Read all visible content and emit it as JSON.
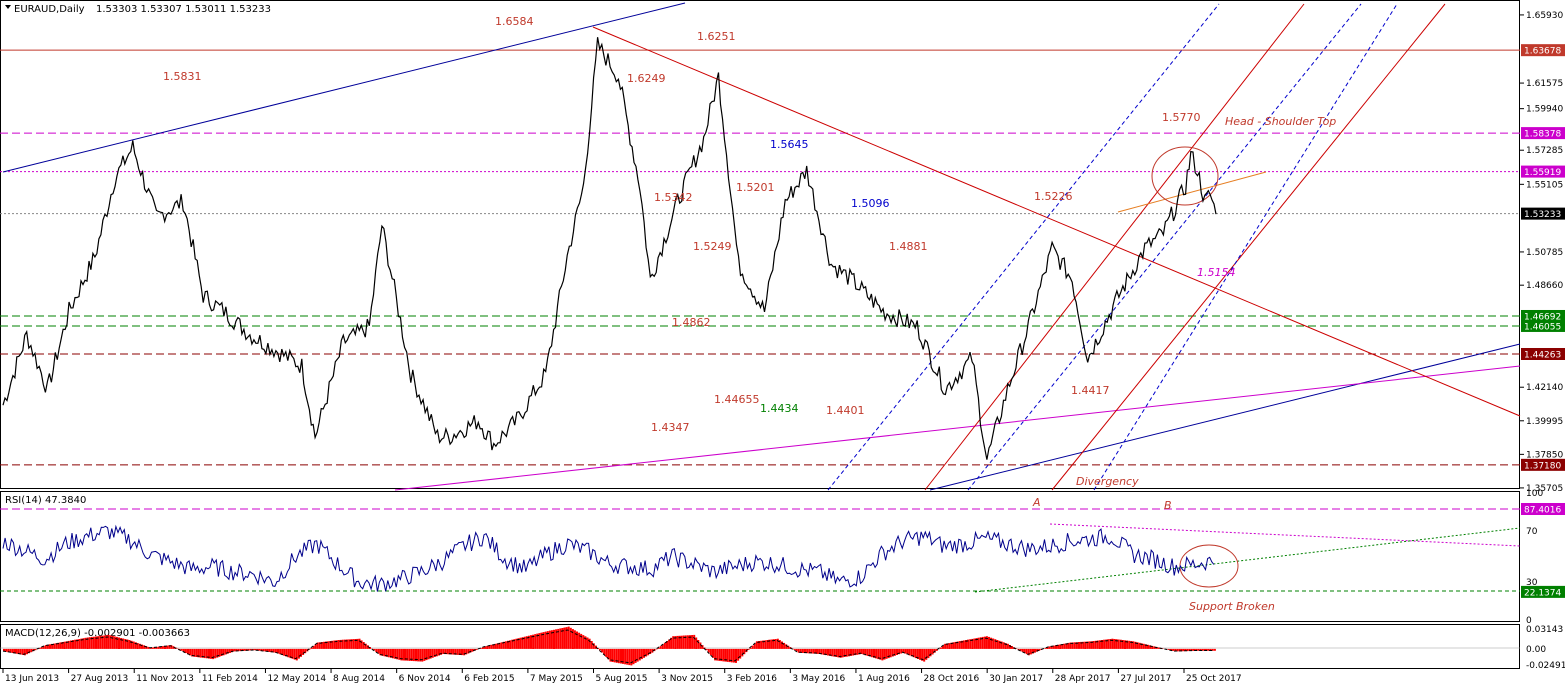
{
  "window": {
    "symbol": "EURAUD,Daily",
    "ohlc": "1.53303 1.53307 1.53011 1.53233"
  },
  "panels": {
    "rsi_title": "RSI(14) 47.3840",
    "macd_title": "MACD(12,26,9) -0.002901 -0.003663"
  },
  "colors": {
    "price": "#000000",
    "level_red": "#c0392b",
    "level_magenta": "#cc00cc",
    "level_green": "#008000",
    "trend_blue": "#000099",
    "rsi": "#00008b",
    "macd_hist": "#ff0000"
  },
  "chart_data": [
    {
      "type": "line",
      "title": "EURAUD,Daily",
      "series_name": "EURAUD",
      "x": [
        "2013-06-13",
        "2013-07-15",
        "2013-08-12",
        "2013-09-10",
        "2013-10-15",
        "2013-11-11",
        "2013-12-05",
        "2014-01-06",
        "2014-02-11",
        "2014-03-10",
        "2014-04-07",
        "2014-05-12",
        "2014-06-16",
        "2014-07-21",
        "2014-08-08",
        "2014-09-15",
        "2014-10-20",
        "2014-11-06",
        "2014-12-15",
        "2015-01-20",
        "2015-02-06",
        "2015-03-16",
        "2015-04-06",
        "2015-05-07",
        "2015-06-15",
        "2015-07-14",
        "2015-08-05",
        "2015-08-24",
        "2015-09-21",
        "2015-10-20",
        "2015-11-03",
        "2015-12-10",
        "2016-01-14",
        "2016-02-03",
        "2016-03-01",
        "2016-04-05",
        "2016-05-03",
        "2016-06-01",
        "2016-07-04",
        "2016-08-01",
        "2016-09-12",
        "2016-10-28",
        "2016-12-05",
        "2017-01-10",
        "2017-01-30",
        "2017-02-27",
        "2017-03-27",
        "2017-04-28",
        "2017-05-25",
        "2017-06-15",
        "2017-07-27",
        "2017-08-31",
        "2017-09-25",
        "2017-10-25",
        "2017-11-01",
        "2017-11-10",
        "2017-11-20",
        "2017-11-27",
        "2017-12-05"
      ],
      "y": [
        1.41,
        1.455,
        1.42,
        1.47,
        1.505,
        1.555,
        1.575,
        1.53,
        1.54,
        1.48,
        1.47,
        1.455,
        1.445,
        1.435,
        1.39,
        1.45,
        1.46,
        1.525,
        1.43,
        1.39,
        1.39,
        1.4,
        1.385,
        1.4,
        1.43,
        1.505,
        1.55,
        1.64,
        1.62,
        1.55,
        1.49,
        1.54,
        1.58,
        1.62,
        1.5,
        1.47,
        1.54,
        1.56,
        1.5,
        1.49,
        1.47,
        1.46,
        1.42,
        1.44,
        1.375,
        1.42,
        1.46,
        1.51,
        1.49,
        1.44,
        1.48,
        1.51,
        1.52,
        1.55,
        1.57,
        1.56,
        1.54,
        1.545,
        1.532
      ],
      "ylim": [
        1.357,
        1.665
      ],
      "y_ticks": [
        "1.65930",
        "1.63678",
        "1.61575",
        "1.59940",
        "1.58378",
        "1.57285",
        "1.55919",
        "1.55105",
        "1.53233",
        "1.50785",
        "1.48660",
        "1.46692",
        "1.46055",
        "1.44263",
        "1.42140",
        "1.39995",
        "1.37850",
        "1.37180",
        "1.35705"
      ],
      "x_ticks": [
        "13 Jun 2013",
        "27 Aug 2013",
        "11 Nov 2013",
        "11 Feb 2014",
        "12 May 2014",
        "8 Aug 2014",
        "6 Nov 2014",
        "6 Feb 2015",
        "7 May 2015",
        "5 Aug 2015",
        "3 Nov 2015",
        "3 Feb 2016",
        "3 May 2016",
        "1 Aug 2016",
        "28 Oct 2016",
        "30 Jan 2017",
        "28 Apr 2017",
        "27 Jul 2017",
        "25 Oct 2017"
      ],
      "horizontal_levels": [
        {
          "value": 1.63678,
          "label": "1.63678",
          "style": "solid",
          "color": "#c0392b"
        },
        {
          "value": 1.58378,
          "label": "1.58378",
          "style": "dashed",
          "color": "#cc00cc"
        },
        {
          "value": 1.55919,
          "label": "1.55919",
          "style": "dotted",
          "color": "#cc00cc"
        },
        {
          "value": 1.53233,
          "label": "1.53233",
          "style": "dotted",
          "color": "#888888"
        },
        {
          "value": 1.46692,
          "label": "1.46692",
          "style": "dashed",
          "color": "#008000"
        },
        {
          "value": 1.46055,
          "label": "1.46055",
          "style": "dashed",
          "color": "#008000"
        },
        {
          "value": 1.44263,
          "label": "1.44263",
          "style": "dashed",
          "color": "#8b0000"
        },
        {
          "value": 1.3718,
          "label": "1.37180",
          "style": "dashed",
          "color": "#8b0000"
        }
      ],
      "annotations": [
        {
          "text": "1.6584",
          "color": "#c0392b"
        },
        {
          "text": "1.5831",
          "color": "#c0392b"
        },
        {
          "text": "1.6251",
          "color": "#c0392b"
        },
        {
          "text": "1.6249",
          "color": "#c0392b"
        },
        {
          "text": "1.5645",
          "color": "#0000cc"
        },
        {
          "text": "1.5770",
          "color": "#c0392b"
        },
        {
          "text": "1.5342",
          "color": "#c0392b"
        },
        {
          "text": "1.5201",
          "color": "#c0392b"
        },
        {
          "text": "1.5096",
          "color": "#0000cc"
        },
        {
          "text": "1.5226",
          "color": "#c0392b"
        },
        {
          "text": "1.5249",
          "color": "#c0392b"
        },
        {
          "text": "1.4881",
          "color": "#c0392b"
        },
        {
          "text": "1.5154",
          "color": "#cc00cc"
        },
        {
          "text": "1.4862",
          "color": "#c0392b"
        },
        {
          "text": "1.4417",
          "color": "#c0392b"
        },
        {
          "text": "1.44655",
          "color": "#c0392b"
        },
        {
          "text": "1.4434",
          "color": "#008000"
        },
        {
          "text": "1.4401",
          "color": "#c0392b"
        },
        {
          "text": "1.4347",
          "color": "#c0392b"
        },
        {
          "text": "Head - Shoulder Top",
          "color": "#c0392b"
        },
        {
          "text": "Divergency",
          "color": "#c0392b"
        }
      ]
    },
    {
      "type": "line",
      "title": "RSI(14) 47.3840",
      "ylim": [
        0,
        100
      ],
      "y_ticks": [
        "100",
        "87.4016",
        "70",
        "30",
        "22.1374",
        "0"
      ],
      "levels": [
        {
          "value": 87.4016,
          "label": "87.4016"
        },
        {
          "value": 22.1374,
          "label": "22.1374"
        }
      ],
      "values": [
        62,
        55,
        48,
        60,
        66,
        70,
        64,
        52,
        46,
        40,
        42,
        38,
        36,
        30,
        50,
        60,
        44,
        30,
        28,
        32,
        38,
        46,
        58,
        66,
        48,
        40,
        52,
        60,
        54,
        44,
        42,
        40,
        50,
        44,
        38,
        42,
        46,
        44,
        40,
        38,
        30,
        34,
        52,
        62,
        66,
        58,
        60,
        64,
        60,
        56,
        58,
        62,
        64,
        66,
        52,
        48,
        42,
        44,
        47.38
      ],
      "annotations": [
        {
          "text": "A"
        },
        {
          "text": "B"
        },
        {
          "text": "Support Broken"
        }
      ]
    },
    {
      "type": "bar",
      "title": "MACD(12,26,9) -0.002901 -0.003663",
      "ylim": [
        -0.03,
        0.036
      ],
      "y_ticks": [
        "0.03143",
        "0.00",
        "-0.02491"
      ],
      "values": [
        -0.004,
        -0.01,
        0.006,
        0.012,
        0.018,
        0.022,
        0.014,
        0.002,
        0.006,
        -0.012,
        -0.016,
        -0.004,
        -0.002,
        -0.006,
        -0.018,
        0.01,
        0.014,
        0.016,
        -0.01,
        -0.018,
        -0.02,
        -0.008,
        -0.01,
        0.004,
        0.012,
        0.02,
        0.028,
        0.035,
        0.016,
        -0.02,
        -0.026,
        -0.006,
        0.02,
        0.022,
        -0.018,
        -0.022,
        0.012,
        0.016,
        -0.006,
        -0.008,
        -0.014,
        -0.008,
        -0.018,
        -0.006,
        -0.02,
        0.008,
        0.014,
        0.02,
        0.008,
        -0.01,
        0.004,
        0.01,
        0.012,
        0.016,
        0.012,
        0.004,
        -0.004,
        -0.003,
        -0.0029
      ]
    }
  ]
}
